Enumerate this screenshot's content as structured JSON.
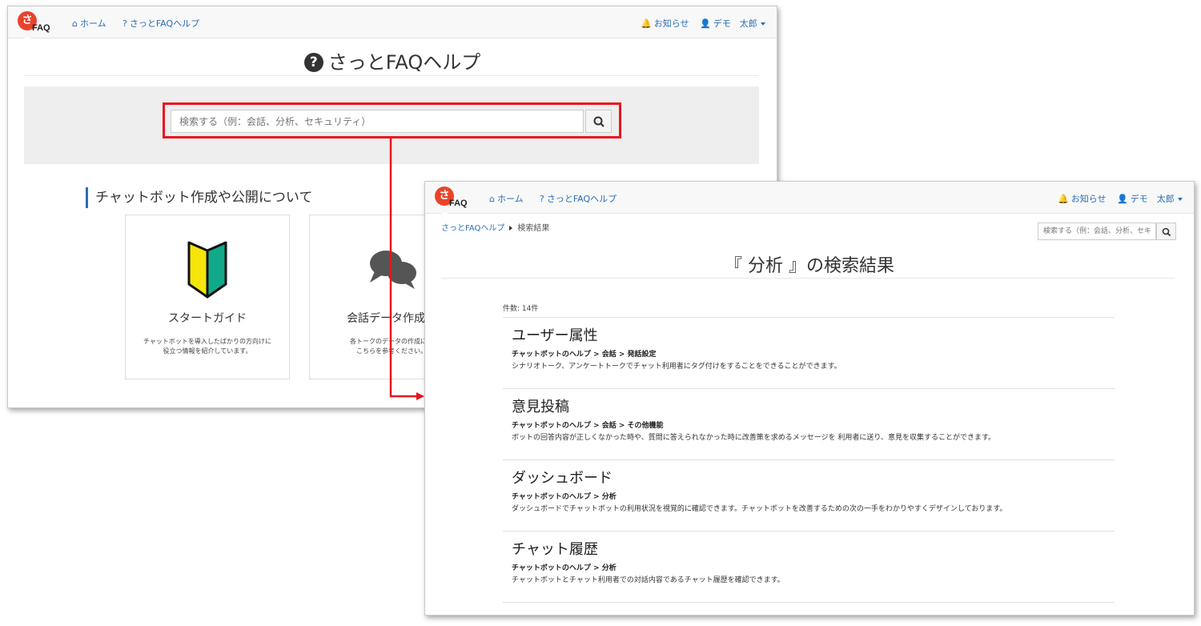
{
  "colors": {
    "accent": "#2a6db6",
    "highlight": "#e8141e",
    "logo": "#e8442b"
  },
  "navbar": {
    "logo_mark": "さっ",
    "logo_text": "FAQ",
    "home": "ホーム",
    "help": "さっとFAQヘルプ",
    "notice": "お知らせ",
    "user": "デモ　太郎"
  },
  "home_page": {
    "title": "さっとFAQヘルプ",
    "search_placeholder": "検索する（例：会話、分析、セキュリティ）",
    "section_title": "チャットボット作成や公開について",
    "cards": [
      {
        "title": "スタートガイド",
        "desc": "チャットボットを導入したばかりの方向けに\n役立つ情報を紹介しています。",
        "icon": "beginner-mark-icon"
      },
      {
        "title": "会話データ作成ガ",
        "desc": "各トークのデータの作成につ\nこちらを参考ください。",
        "icon": "chat-bubbles-icon"
      }
    ]
  },
  "results_page": {
    "breadcrumb": {
      "root": "さっとFAQヘルプ",
      "current": "検索結果"
    },
    "search_placeholder": "検索する（例：会話、分析、セキュリティ）",
    "title": "『 分析 』の検索結果",
    "count": "件数: 14件",
    "results": [
      {
        "title": "ユーザー属性",
        "path": "チャットボットのヘルプ > 会話 > 発話設定",
        "desc": "シナリオトーク、アンケートトークでチャット利用者にタグ付けをすることをできることができます。"
      },
      {
        "title": "意見投稿",
        "path": "チャットボットのヘルプ > 会話 > その他機能",
        "desc": "ボットの回答内容が正しくなかった時や、質問に答えられなかった時に改善策を求めるメッセージを 利用者に送り、意見を収集することができます。"
      },
      {
        "title": "ダッシュボード",
        "path": "チャットボットのヘルプ > 分析",
        "desc": "ダッシュボードでチャットボットの利用状況を視覚的に確認できます。チャットボットを改善するための次の一手をわかりやすくデザインしております。"
      },
      {
        "title": "チャット履歴",
        "path": "チャットボットのヘルプ > 分析",
        "desc": "チャットボットとチャット利用者での対話内容であるチャット履歴を確認できます。"
      }
    ]
  }
}
